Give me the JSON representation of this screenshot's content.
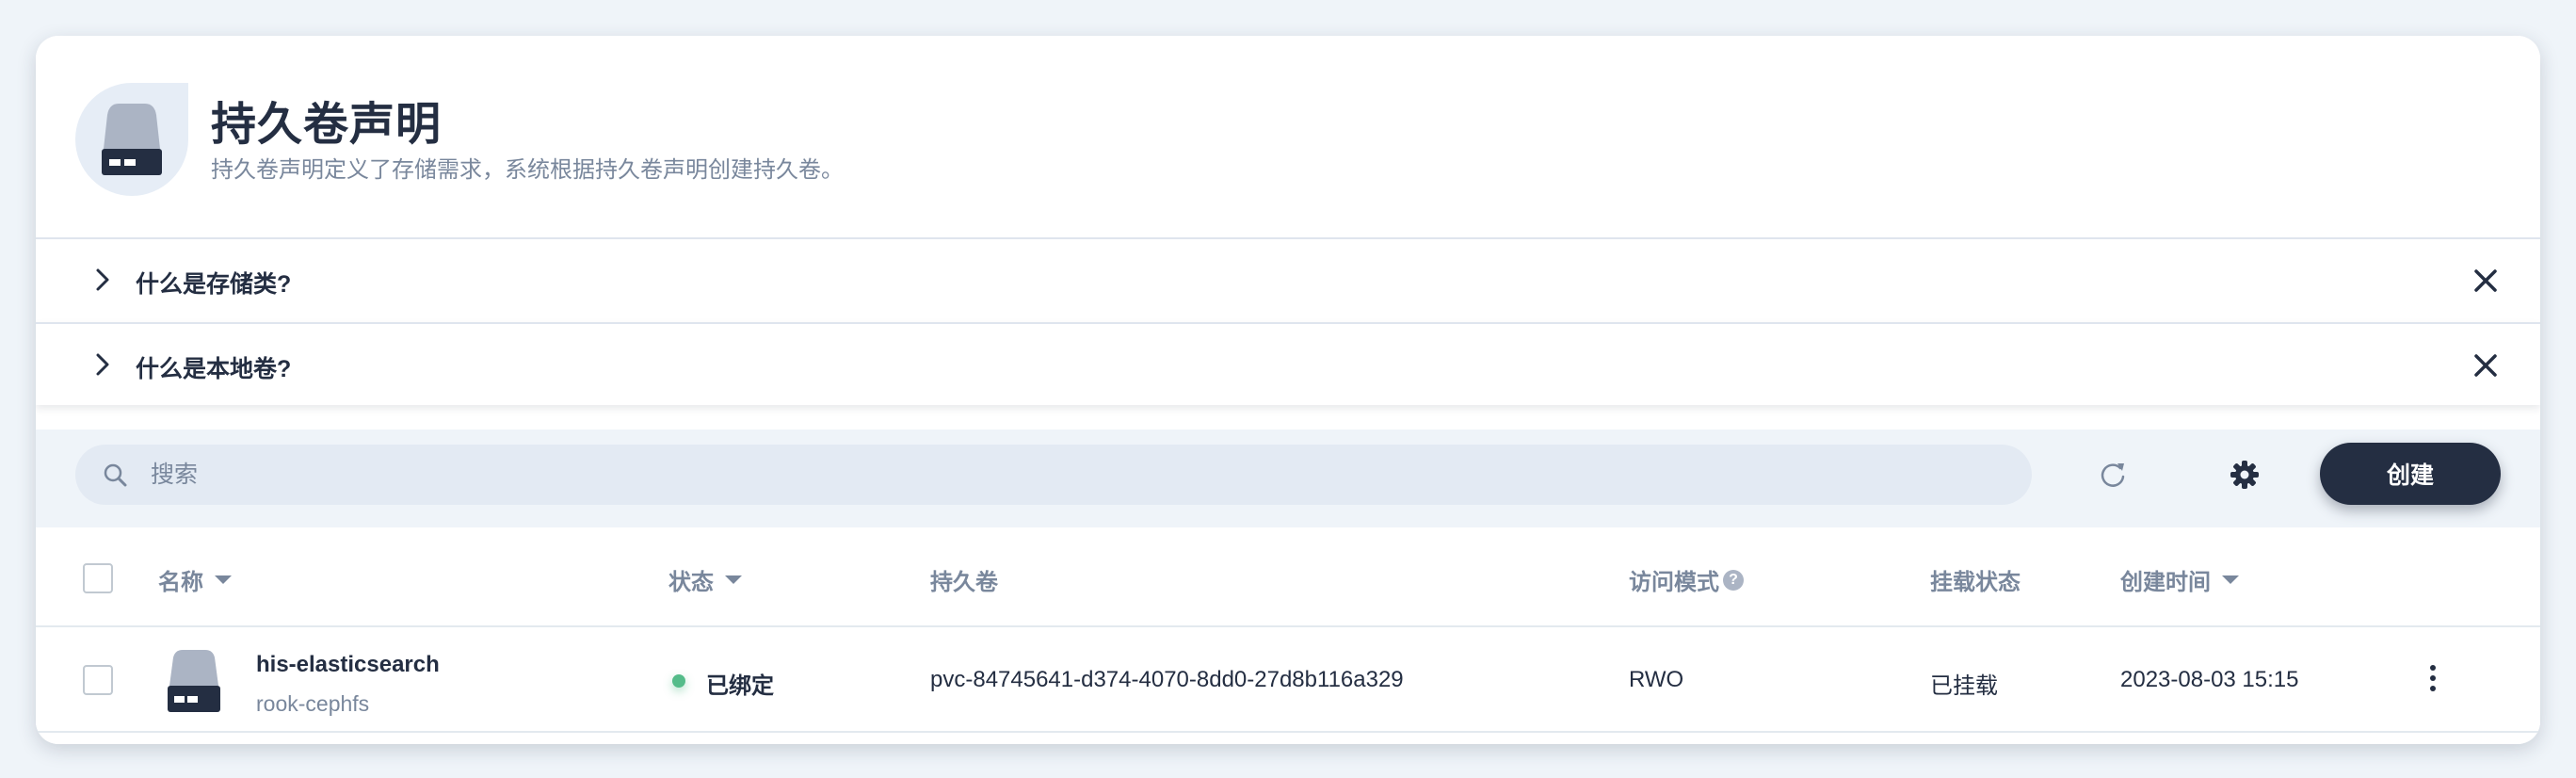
{
  "header": {
    "title": "持久卷声明",
    "description": "持久卷声明定义了存储需求，系统根据持久卷声明创建持久卷。"
  },
  "accordions": [
    {
      "label": "什么是存储类?"
    },
    {
      "label": "什么是本地卷?"
    }
  ],
  "toolbar": {
    "search_placeholder": "搜索",
    "create_label": "创建"
  },
  "table": {
    "columns": {
      "name": "名称",
      "status": "状态",
      "volume": "持久卷",
      "access_mode": "访问模式",
      "access_mode_help": "?",
      "mount_status": "挂载状态",
      "created": "创建时间"
    },
    "rows": [
      {
        "name": "his-elasticsearch",
        "storage_class": "rook-cephfs",
        "status": "已绑定",
        "status_color": "#55bc8a",
        "volume": "pvc-84745641-d374-4070-8dd0-27d8b116a329",
        "access_mode": "RWO",
        "mount_status": "已挂载",
        "created": "2023-08-03 15:15"
      }
    ]
  },
  "icons": [
    "disk-icon",
    "chevron-right-icon",
    "close-icon",
    "search-icon",
    "refresh-icon",
    "gear-icon",
    "more-vertical-icon"
  ],
  "colors": {
    "primary_dark": "#242e42",
    "muted": "#79879c",
    "success": "#55bc8a",
    "page_bg": "#eff4f9"
  }
}
